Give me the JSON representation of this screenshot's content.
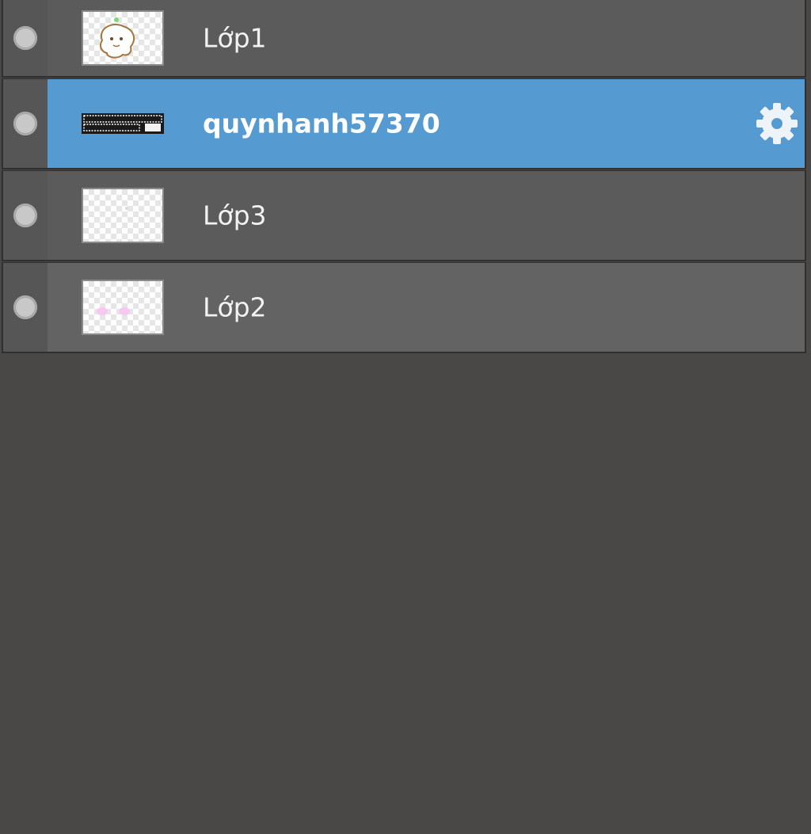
{
  "layers": [
    {
      "name": "Lớp1",
      "visible": true,
      "thumbnail": "cartoon-face-sketch",
      "selected": false
    },
    {
      "name": "quynhanh57370",
      "visible": true,
      "thumbnail": "text-layer",
      "selected": true
    },
    {
      "name": "Lớp3",
      "visible": true,
      "thumbnail": "mostly-transparent",
      "selected": false
    },
    {
      "name": "Lớp2",
      "visible": true,
      "thumbnail": "pink-dots",
      "selected": false
    }
  ],
  "icons": {
    "visibility": "visibility-dot-icon",
    "settings": "gear-icon"
  },
  "colors": {
    "panel_bg": "#494847",
    "row_bg": "#5b5b5b",
    "selected_bg": "#559bd1",
    "text": "#f2f2f2"
  }
}
